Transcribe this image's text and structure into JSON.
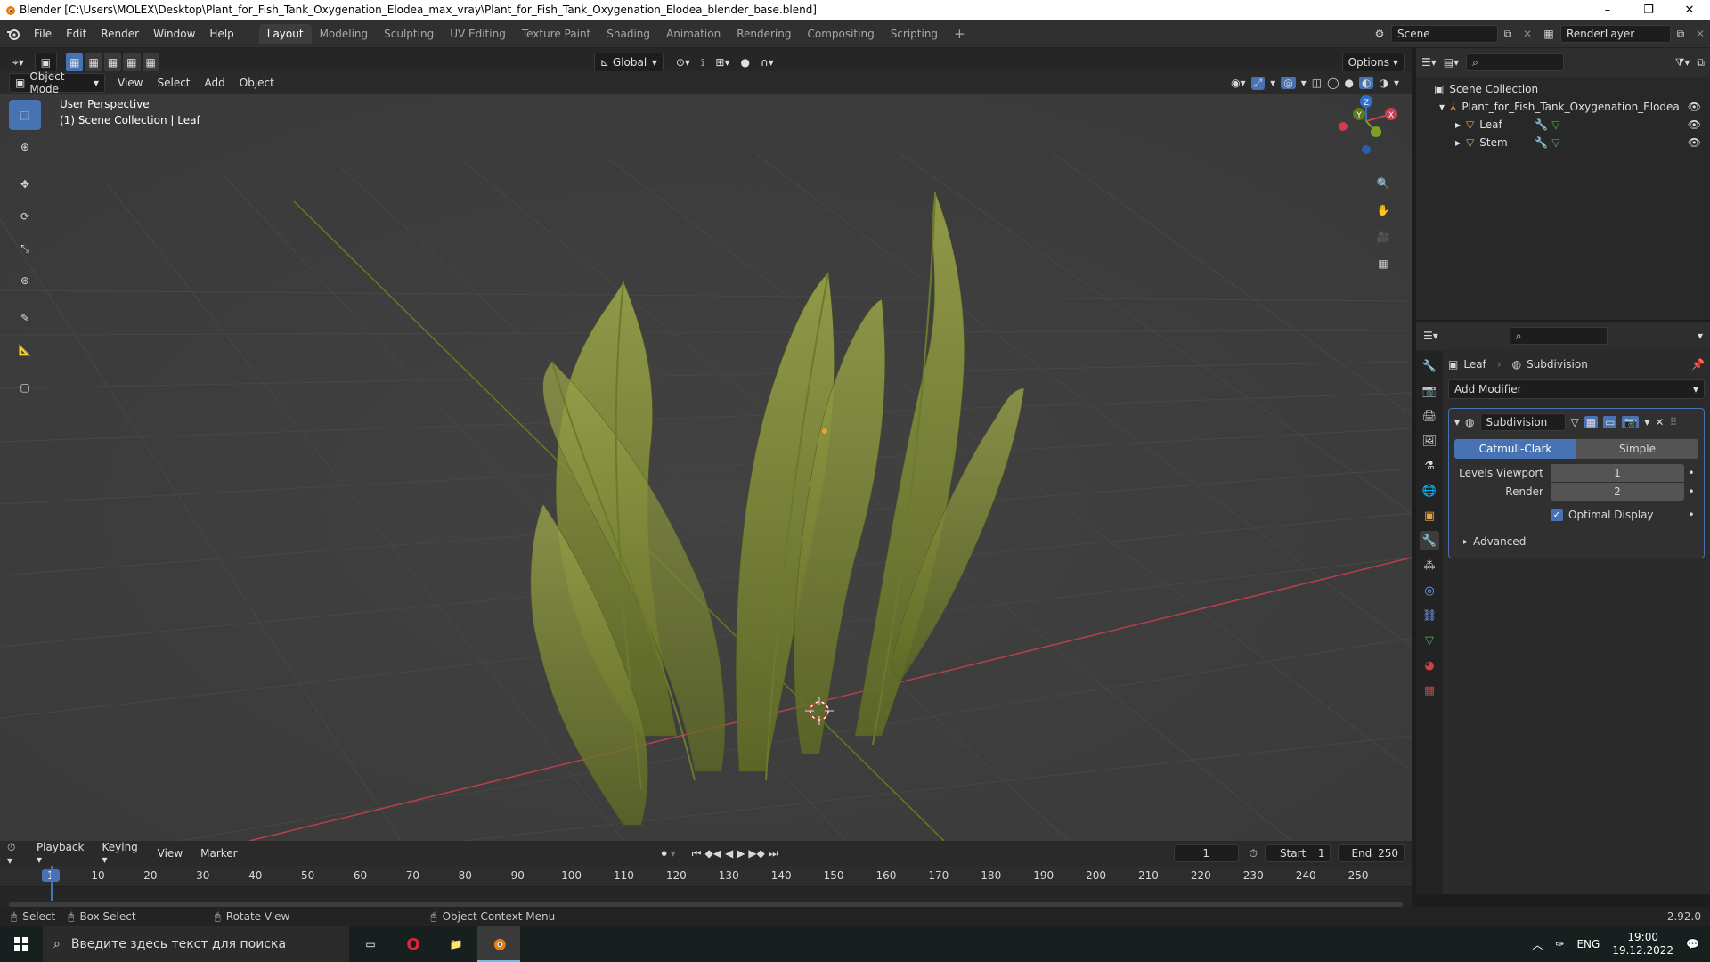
{
  "window": {
    "title": "Blender [C:\\Users\\MOLEX\\Desktop\\Plant_for_Fish_Tank_Oxygenation_Elodea_max_vray\\Plant_for_Fish_Tank_Oxygenation_Elodea_blender_base.blend]",
    "minimize": "–",
    "maximize": "❐",
    "close": "✕"
  },
  "menus": [
    "File",
    "Edit",
    "Render",
    "Window",
    "Help"
  ],
  "workspaces": [
    "Layout",
    "Modeling",
    "Sculpting",
    "UV Editing",
    "Texture Paint",
    "Shading",
    "Animation",
    "Rendering",
    "Compositing",
    "Scripting"
  ],
  "active_workspace": "Layout",
  "scene": "Scene",
  "render_layer": "RenderLayer",
  "viewport_header": {
    "transform": "Global",
    "options": "Options",
    "mode": "Object Mode",
    "menu": [
      "View",
      "Select",
      "Add",
      "Object"
    ]
  },
  "viewport": {
    "perspective": "User Perspective",
    "collection_info": "(1) Scene Collection | Leaf",
    "gizmo": {
      "x": "X",
      "y": "Y",
      "z": "Z"
    }
  },
  "outliner": {
    "root": "Scene Collection",
    "collection": "Plant_for_Fish_Tank_Oxygenation_Elodea",
    "objects": [
      "Leaf",
      "Stem"
    ]
  },
  "properties": {
    "breadcrumb_object": "Leaf",
    "breadcrumb_modifier": "Subdivision",
    "add_modifier": "Add Modifier",
    "modifier_name": "Subdivision",
    "type_options": [
      "Catmull-Clark",
      "Simple"
    ],
    "selected_type": "Catmull-Clark",
    "levels_viewport_label": "Levels Viewport",
    "levels_viewport_value": "1",
    "render_label": "Render",
    "render_value": "2",
    "optimal_display": "Optimal Display",
    "optimal_display_checked": true,
    "advanced": "Advanced"
  },
  "timeline": {
    "menus": [
      "Playback",
      "Keying",
      "View",
      "Marker"
    ],
    "current_frame": "1",
    "start_label": "Start",
    "start_value": "1",
    "end_label": "End",
    "end_value": "250",
    "ruler": [
      "1",
      "10",
      "20",
      "30",
      "40",
      "50",
      "60",
      "70",
      "80",
      "90",
      "100",
      "110",
      "120",
      "130",
      "140",
      "150",
      "160",
      "170",
      "180",
      "190",
      "200",
      "210",
      "220",
      "230",
      "240",
      "250"
    ]
  },
  "status": {
    "select": "Select",
    "box_select": "Box Select",
    "rotate_view": "Rotate View",
    "context_menu": "Object Context Menu",
    "version": "2.92.0"
  },
  "taskbar": {
    "search_placeholder": "Введите здесь текст для поиска",
    "lang": "ENG",
    "time": "19:00",
    "date": "19.12.2022"
  },
  "colors": {
    "accent": "#4772b3",
    "x_axis": "#c84152",
    "y_axis": "#7ea024",
    "z_axis": "#2f6fd0"
  }
}
